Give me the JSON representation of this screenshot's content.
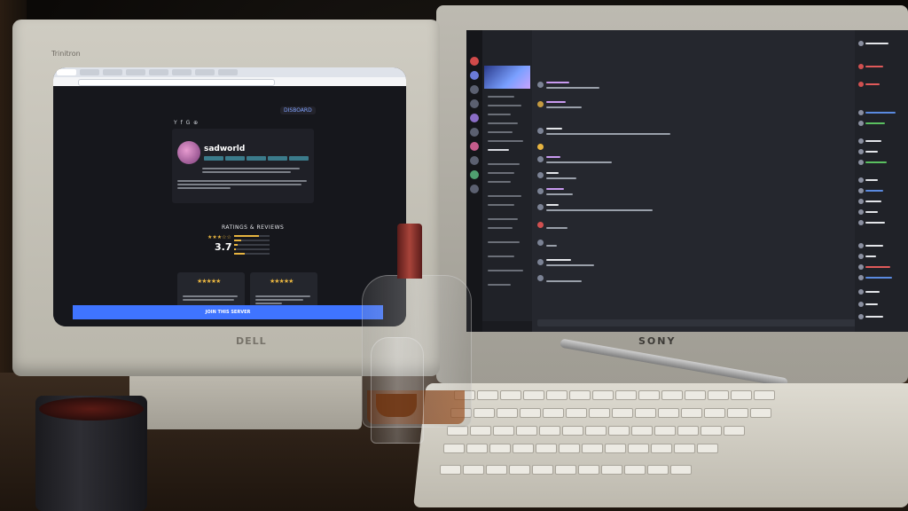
{
  "scene": {
    "description_free": true
  },
  "dell_monitor": {
    "brand_top": "Trinitron",
    "logo": "DELL"
  },
  "sony_monitor": {
    "logo": "SONY"
  },
  "browser": {
    "site_logo": "DISBOARD"
  },
  "disboard_page": {
    "server_name": "sadworld",
    "social_icons": "Y f G ⊕",
    "ratings_title": "RATINGS & REVIEWS",
    "rating_stars": "★★★☆☆",
    "rating_value": "3.7",
    "review_stars": "★★★★★",
    "join_button": "JOIN THIS SERVER"
  },
  "colors": {
    "join_button": "#3f74ff",
    "star": "#e7b440",
    "discord_bg": "#25272e",
    "bottle_label": "#a8443a"
  },
  "icons": [
    "twitter-icon",
    "facebook-icon",
    "youtube-icon",
    "link-icon",
    "discord-server-icon"
  ]
}
